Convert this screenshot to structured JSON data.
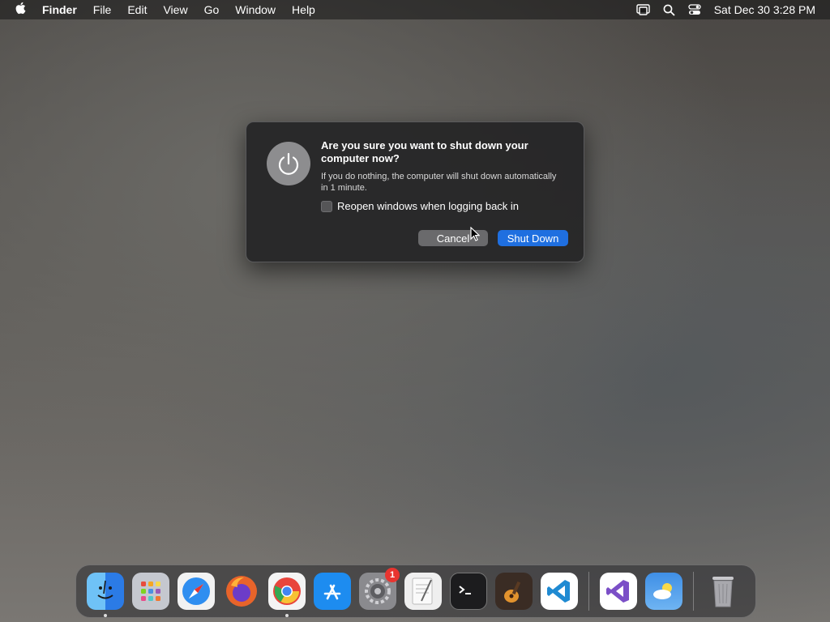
{
  "menubar": {
    "apple_icon": "apple-logo-icon",
    "app_name": "Finder",
    "menus": [
      "File",
      "Edit",
      "View",
      "Go",
      "Window",
      "Help"
    ],
    "status_icons": [
      "screen-mirroring-icon",
      "search-icon",
      "control-center-icon"
    ],
    "clock": "Sat Dec 30  3:28 PM"
  },
  "dialog": {
    "icon": "power-icon",
    "title": "Are you sure you want to shut down your computer now?",
    "body": "If you do nothing, the computer will shut down automatically in 1 minute.",
    "checkbox_label": "Reopen windows when logging back in",
    "checkbox_checked": false,
    "cancel_label": "Cancel",
    "confirm_label": "Shut Down",
    "confirm_color": "#1f6fe0"
  },
  "dock": {
    "apps": [
      {
        "name": "Finder",
        "icon": "finder-icon",
        "running": true,
        "color": "#3b8fe8"
      },
      {
        "name": "Launchpad",
        "icon": "launchpad-icon",
        "running": false,
        "color": "#b9bcc4"
      },
      {
        "name": "Safari",
        "icon": "safari-icon",
        "running": false,
        "color": "#2f8ef0"
      },
      {
        "name": "Firefox",
        "icon": "firefox-icon",
        "running": false,
        "color": "#e8642a"
      },
      {
        "name": "Chrome",
        "icon": "chrome-icon",
        "running": true,
        "color": "#f2f2f2"
      },
      {
        "name": "App Store",
        "icon": "app-store-icon",
        "running": false,
        "color": "#1d8cf0"
      },
      {
        "name": "System Settings",
        "icon": "system-settings-icon",
        "running": false,
        "color": "#8a8a8e",
        "badge": "1"
      },
      {
        "name": "TextEdit",
        "icon": "textedit-icon",
        "running": false,
        "color": "#efefef"
      },
      {
        "name": "Terminal",
        "icon": "terminal-icon",
        "running": false,
        "color": "#1c1c1e"
      },
      {
        "name": "GarageBand",
        "icon": "garageband-icon",
        "running": false,
        "color": "#3a2c24"
      },
      {
        "name": "VS Code",
        "icon": "vscode-icon",
        "running": false,
        "color": "#ffffff"
      }
    ],
    "recent_apps": [
      {
        "name": "Visual Studio",
        "icon": "visual-studio-icon",
        "running": false,
        "color": "#ffffff"
      },
      {
        "name": "Weather",
        "icon": "weather-icon",
        "running": false,
        "color": "#3f8fe6"
      }
    ],
    "trash": {
      "name": "Trash",
      "icon": "trash-icon"
    }
  },
  "wallpaper_note_color": "#5e5b57"
}
